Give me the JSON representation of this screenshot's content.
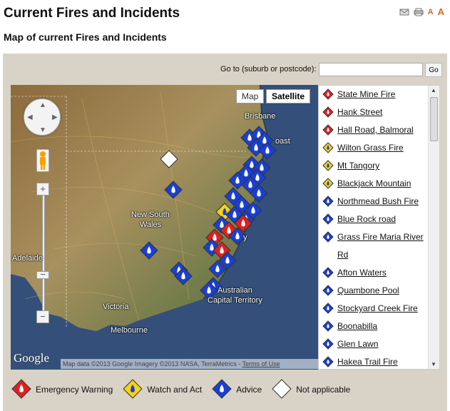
{
  "header": {
    "title": "Current Fires and Incidents",
    "subtitle": "Map of current Fires and Incidents",
    "tools": {
      "email_icon": "email-icon",
      "print_icon": "print-icon",
      "text_small": "A",
      "text_large": "A"
    }
  },
  "search": {
    "label": "Go to (suburb or postcode):",
    "value": "",
    "placeholder": "",
    "go_label": "Go"
  },
  "map": {
    "type_buttons": [
      "Map",
      "Satellite"
    ],
    "selected_type": "Satellite",
    "places": {
      "brisbane": "Brisbane",
      "coast": "oast",
      "nsw1": "New South",
      "nsw2": "Wales",
      "adelaide": "Adelaide",
      "victoria": "Victoria",
      "melbourne": "Melbourne",
      "act1": "Australian",
      "act2": "Capital Territory",
      "sydney_fragment": "y"
    },
    "logo": "Google",
    "attribution": "Map data ©2013 Google Imagery ©2013 NASA, TerraMetrics - ",
    "terms": "Terms of Use",
    "zoom_in": "+",
    "zoom_out": "−",
    "zoom_knob": "−"
  },
  "incidents": [
    {
      "name": "State Mine Fire",
      "level": "emergency"
    },
    {
      "name": "Hank Street",
      "level": "emergency"
    },
    {
      "name": "Hall Road, Balmoral",
      "level": "emergency"
    },
    {
      "name": "Wilton Grass Fire",
      "level": "watch"
    },
    {
      "name": "Mt Tangory",
      "level": "watch"
    },
    {
      "name": "Blackjack Mountain",
      "level": "watch"
    },
    {
      "name": "Northmead Bush Fire",
      "level": "advice"
    },
    {
      "name": "Blue Rock road",
      "level": "advice"
    },
    {
      "name": "Grass Fire Maria River",
      "cont": "Rd",
      "level": "advice"
    },
    {
      "name": "Afton Waters",
      "level": "advice"
    },
    {
      "name": "Quambone Pool",
      "level": "advice"
    },
    {
      "name": "Stockyard Creek Fire",
      "level": "advice"
    },
    {
      "name": "Boonabilla",
      "level": "advice"
    },
    {
      "name": "Glen Lawn",
      "level": "advice"
    },
    {
      "name": "Hakea Trail Fire",
      "level": "advice"
    }
  ],
  "legend": [
    {
      "label": "Emergency Warning",
      "level": "emergency"
    },
    {
      "label": "Watch and Act",
      "level": "watch"
    },
    {
      "label": "Advice",
      "level": "advice"
    },
    {
      "label": "Not applicable",
      "level": "na"
    }
  ],
  "colors": {
    "emergency": "#e02020",
    "watch": "#f2d21a",
    "advice": "#1a3fd6",
    "na": "#ffffff",
    "panel": "#d8d3c6",
    "ocean": "#34507a",
    "land": "#a08a5a"
  }
}
